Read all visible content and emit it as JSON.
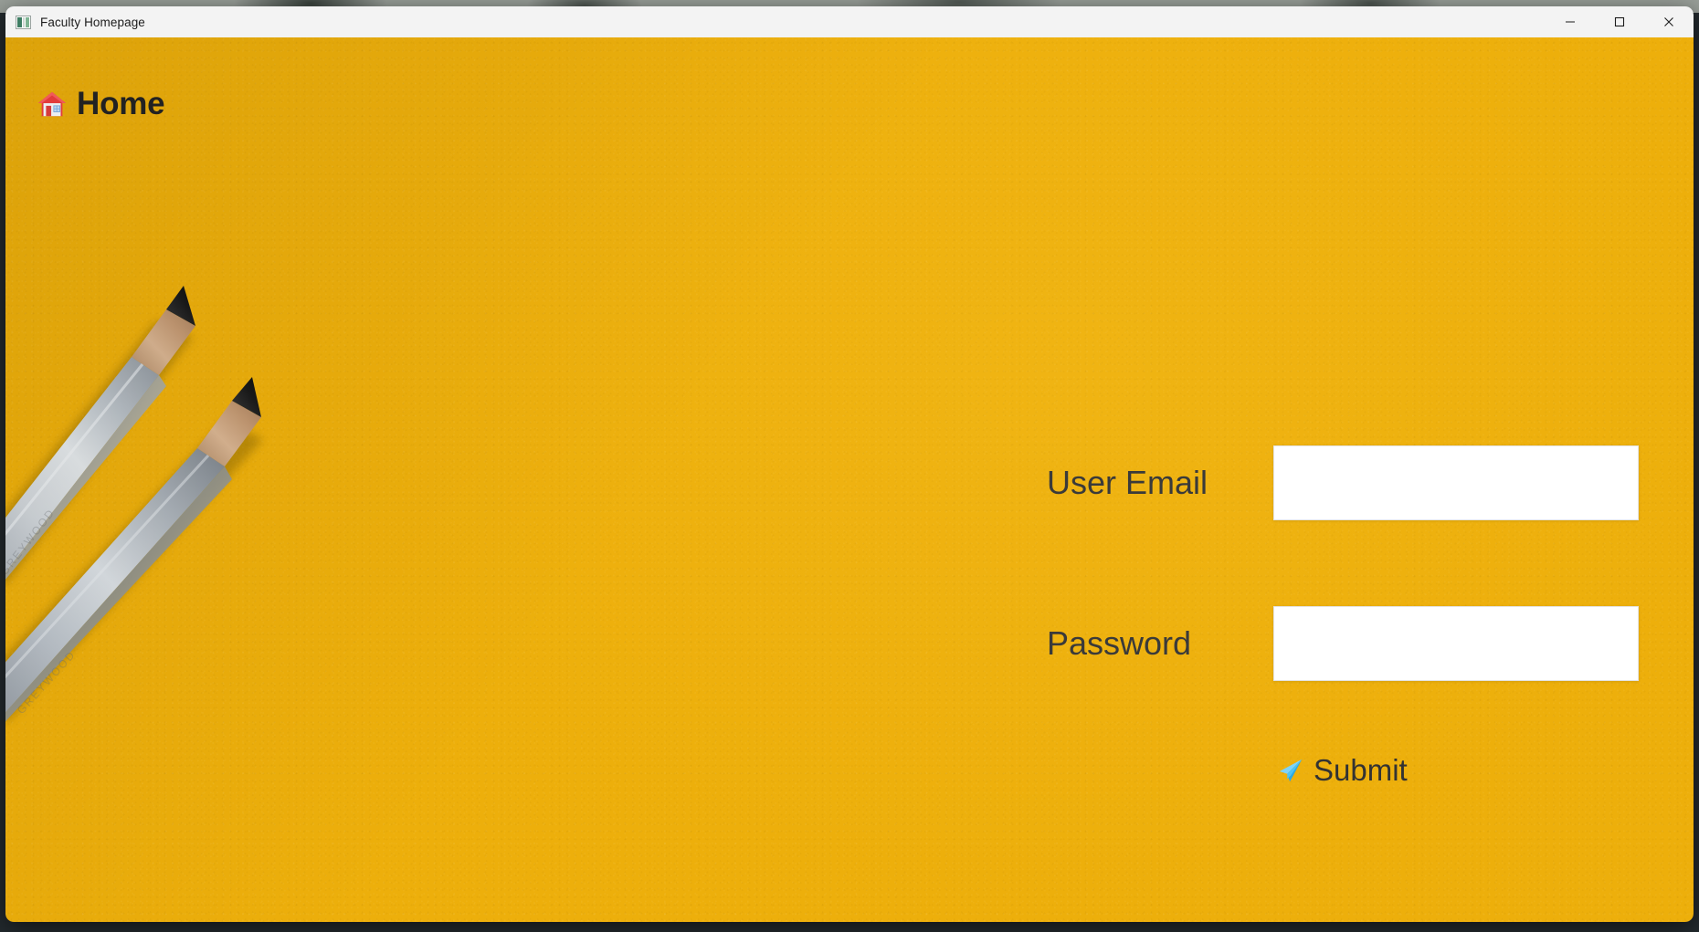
{
  "window": {
    "title": "Faculty Homepage",
    "app_icon": "app-window-icon",
    "controls": {
      "minimize": "minimize-icon",
      "maximize": "maximize-icon",
      "close": "close-icon"
    }
  },
  "page": {
    "background_color": "#edaf0b",
    "background_image": "two-gray-pencils-on-yellow-paper",
    "header": {
      "icon": "house-icon",
      "title": "Home"
    }
  },
  "form": {
    "fields": [
      {
        "label": "User Email",
        "value": "",
        "placeholder": "",
        "type": "text",
        "name": "user-email"
      },
      {
        "label": "Password",
        "value": "",
        "placeholder": "",
        "type": "password",
        "name": "password"
      }
    ],
    "submit": {
      "icon": "paper-plane-icon",
      "label": "Submit"
    }
  },
  "colors": {
    "page_background": "#edaf0b",
    "titlebar_background": "#f3f3f3",
    "text_dark": "#333333",
    "heading_dark": "#222222",
    "input_background": "#ffffff",
    "plane_blue": "#35b8f0",
    "house_red": "#e23b3b"
  }
}
